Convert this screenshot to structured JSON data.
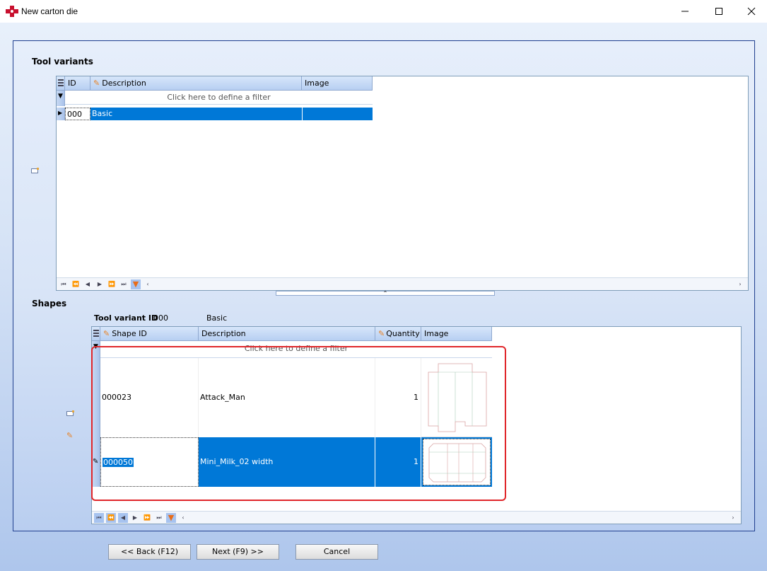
{
  "window": {
    "title": "New carton die",
    "minimize_icon": "minimize-icon",
    "maximize_icon": "maximize-icon",
    "close_icon": "close-icon"
  },
  "tool_variants": {
    "title": "Tool variants",
    "columns": [
      "ID",
      "Description",
      "Image"
    ],
    "filter_hint": "Click here to define a filter",
    "rows": [
      {
        "id": "000",
        "description": "Basic",
        "image": ""
      }
    ]
  },
  "shapes": {
    "title": "Shapes",
    "tool_variant_label": "Tool variant ID",
    "tool_variant_id": "000",
    "tool_variant_desc": "Basic",
    "columns": [
      "Shape ID",
      "Description",
      "Quantity",
      "Image"
    ],
    "filter_hint": "Click here to define a filter",
    "rows": [
      {
        "shape_id": "000023",
        "description": "Attack_Man",
        "quantity": "1"
      },
      {
        "shape_id": "000050",
        "description": "Mini_Milk_02 width",
        "quantity": "1"
      }
    ]
  },
  "buttons": {
    "back": "<< Back (F12)",
    "next": "Next (F9) >>",
    "cancel": "Cancel"
  },
  "colors": {
    "selection": "#0078d7",
    "highlight_box": "#e0262a",
    "panel_border": "#1f3f8f"
  }
}
